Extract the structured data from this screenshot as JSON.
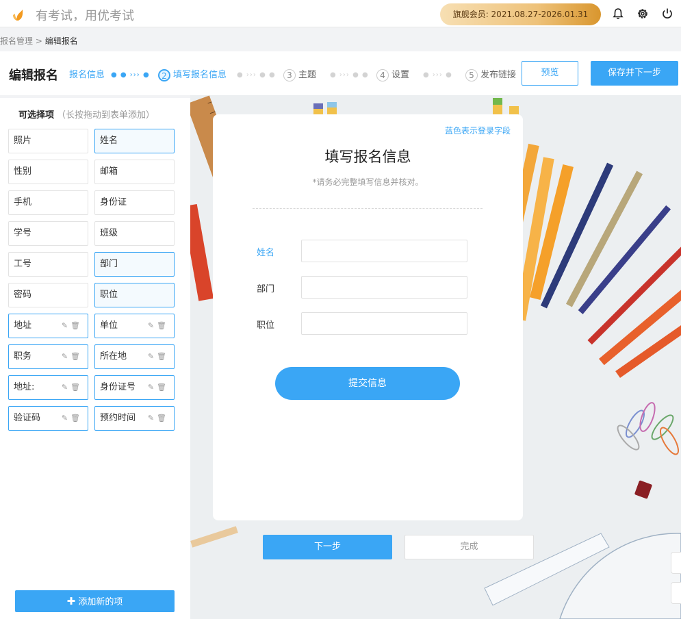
{
  "app": {
    "slogan": "有考试，用优考试",
    "vip_text": "旗舰会员:  2021.08.27-2026.01.31",
    "accent": "#3aa6f5"
  },
  "topbar_icons": [
    "bell-icon",
    "gear-icon",
    "power-icon"
  ],
  "breadcrumb": {
    "parent": "报名管理",
    "sep": " > ",
    "current": "编辑报名"
  },
  "header": {
    "title": "编辑报名",
    "steps": [
      {
        "num": "",
        "label": "报名信息",
        "state": "done"
      },
      {
        "num": "2",
        "label": "填写报名信息",
        "state": "active"
      },
      {
        "num": "3",
        "label": "主题",
        "state": "todo"
      },
      {
        "num": "4",
        "label": "设置",
        "state": "todo"
      },
      {
        "num": "5",
        "label": "发布链接",
        "state": "todo"
      }
    ],
    "preview_label": "预览",
    "save_next_label": "保存并下一步"
  },
  "left_panel": {
    "title": "可选择项",
    "hint": "（长按拖动到表单添加）",
    "fields": [
      {
        "label": "照片",
        "state": "normal"
      },
      {
        "label": "姓名",
        "state": "selected"
      },
      {
        "label": "性别",
        "state": "normal"
      },
      {
        "label": "邮箱",
        "state": "normal"
      },
      {
        "label": "手机",
        "state": "normal"
      },
      {
        "label": "身份证",
        "state": "normal"
      },
      {
        "label": "学号",
        "state": "normal"
      },
      {
        "label": "班级",
        "state": "normal"
      },
      {
        "label": "工号",
        "state": "normal"
      },
      {
        "label": "部门",
        "state": "selected"
      },
      {
        "label": "密码",
        "state": "normal"
      },
      {
        "label": "职位",
        "state": "selected"
      },
      {
        "label": "地址",
        "state": "custom"
      },
      {
        "label": "单位",
        "state": "custom"
      },
      {
        "label": "职务",
        "state": "custom"
      },
      {
        "label": "所在地",
        "state": "custom"
      },
      {
        "label": "地址:",
        "state": "custom"
      },
      {
        "label": "身份证号",
        "state": "custom"
      },
      {
        "label": "验证码",
        "state": "custom"
      },
      {
        "label": "预约时间",
        "state": "custom"
      }
    ],
    "add_label": "添加新的项"
  },
  "form": {
    "note": "蓝色表示登录字段",
    "title": "填写报名信息",
    "subtitle": "*请务必完整填写信息并核对。",
    "fields": [
      {
        "label": "姓名",
        "value": "",
        "login": true
      },
      {
        "label": "部门",
        "value": "",
        "login": false
      },
      {
        "label": "职位",
        "value": "",
        "login": false
      }
    ],
    "submit_label": "提交信息"
  },
  "footer": {
    "next_label": "下一步",
    "done_label": "完成"
  }
}
